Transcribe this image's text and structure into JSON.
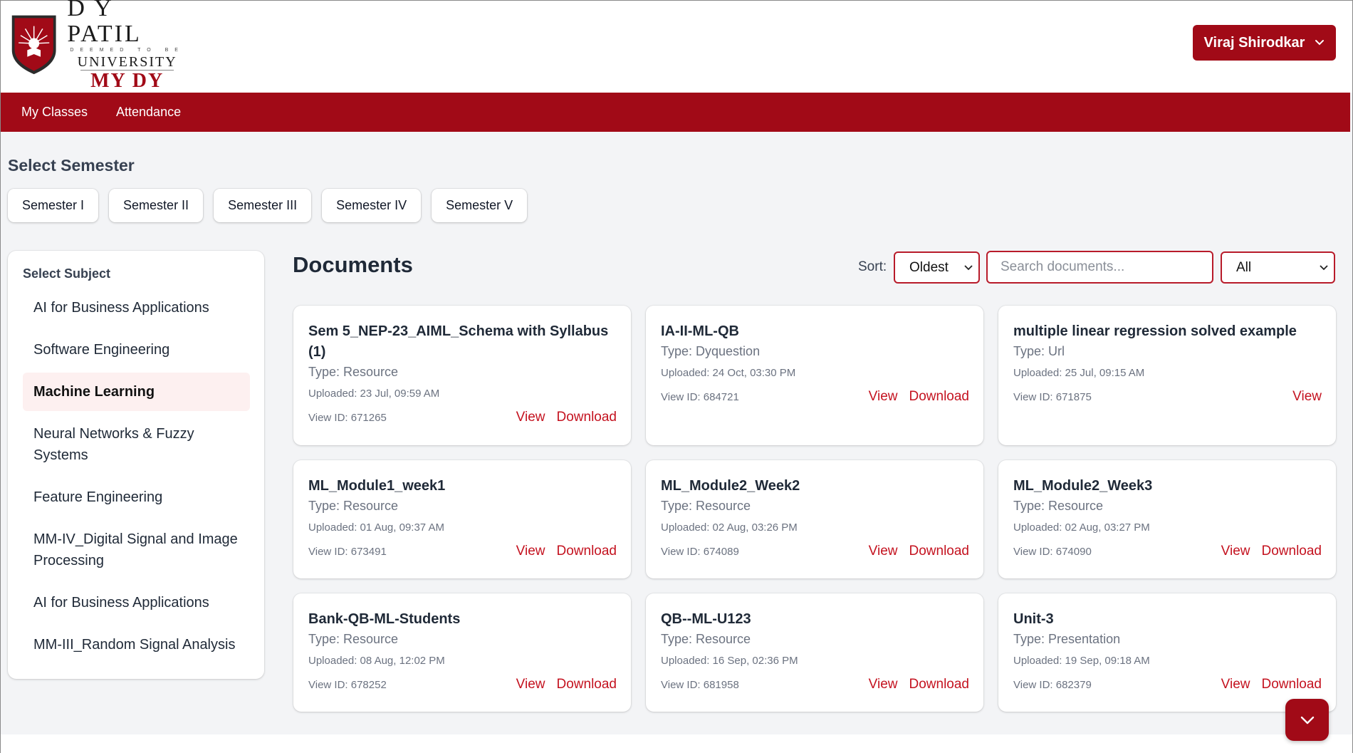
{
  "brand": {
    "line1": "D Y PATIL",
    "line2": "DEEMED TO BE",
    "line3": "UNIVERSITY",
    "line4": "MY DY",
    "accent_color": "#a10a17"
  },
  "user_menu": {
    "label": "Viraj Shirodkar",
    "icon": "chevron-down-icon"
  },
  "nav": {
    "items": [
      "My Classes",
      "Attendance"
    ]
  },
  "semester": {
    "title": "Select Semester",
    "options": [
      "Semester I",
      "Semester II",
      "Semester III",
      "Semester IV",
      "Semester V"
    ]
  },
  "sidebar": {
    "title": "Select Subject",
    "subjects": [
      "AI for Business Applications",
      "Software Engineering",
      "Machine Learning",
      "Neural Networks & Fuzzy Systems",
      "Feature Engineering",
      "MM-IV_Digital Signal and Image Processing",
      "AI for Business Applications",
      "MM-III_Random Signal Analysis"
    ],
    "active_index": 2
  },
  "documents": {
    "title": "Documents",
    "sort_label": "Sort:",
    "sort_value": "Oldest",
    "search_placeholder": "Search documents...",
    "filter_value": "All",
    "view_label": "View",
    "download_label": "Download",
    "cards": [
      {
        "title": "Sem 5_NEP-23_AIML_Schema with Syllabus (1)",
        "type": "Type: Resource",
        "uploaded": "Uploaded: 23 Jul, 09:59 AM",
        "view_id": "View ID: 671265",
        "download": true
      },
      {
        "title": "IA-II-ML-QB",
        "type": "Type: Dyquestion",
        "uploaded": "Uploaded: 24 Oct, 03:30 PM",
        "view_id": "View ID: 684721",
        "download": true
      },
      {
        "title": "multiple linear regression solved example",
        "type": "Type: Url",
        "uploaded": "Uploaded: 25 Jul, 09:15 AM",
        "view_id": "View ID: 671875",
        "download": false
      },
      {
        "title": "ML_Module1_week1",
        "type": "Type: Resource",
        "uploaded": "Uploaded: 01 Aug, 09:37 AM",
        "view_id": "View ID: 673491",
        "download": true
      },
      {
        "title": "ML_Module2_Week2",
        "type": "Type: Resource",
        "uploaded": "Uploaded: 02 Aug, 03:26 PM",
        "view_id": "View ID: 674089",
        "download": true
      },
      {
        "title": "ML_Module2_Week3",
        "type": "Type: Resource",
        "uploaded": "Uploaded: 02 Aug, 03:27 PM",
        "view_id": "View ID: 674090",
        "download": true
      },
      {
        "title": "Bank-QB-ML-Students",
        "type": "Type: Resource",
        "uploaded": "Uploaded: 08 Aug, 12:02 PM",
        "view_id": "View ID: 678252",
        "download": true
      },
      {
        "title": "QB--ML-U123",
        "type": "Type: Resource",
        "uploaded": "Uploaded: 16 Sep, 02:36 PM",
        "view_id": "View ID: 681958",
        "download": true
      },
      {
        "title": "Unit-3",
        "type": "Type: Presentation",
        "uploaded": "Uploaded: 19 Sep, 09:18 AM",
        "view_id": "View ID: 682379",
        "download": true
      }
    ]
  }
}
